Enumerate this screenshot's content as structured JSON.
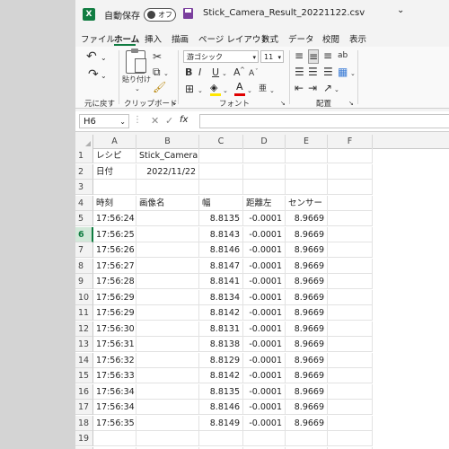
{
  "titlebar": {
    "excel_icon": "excel-logo",
    "autosave_label": "自動保存",
    "toggle_state": "オフ",
    "filename": "Stick_Camera_Result_20221122.csv",
    "filename_chevron": "⌄"
  },
  "tabs": [
    "ファイル",
    "ホーム",
    "挿入",
    "描画",
    "ページ レイアウト",
    "数式",
    "データ",
    "校閲",
    "表示"
  ],
  "active_tab": "ホーム",
  "ribbon": {
    "undo_label": "元に戻す",
    "clipboard_label": "クリップボード",
    "paste_label": "貼り付け",
    "font_label": "フォント",
    "alignment_label": "配置",
    "font_name": "游ゴシック",
    "font_size": "11",
    "bold": "B",
    "italic": "I",
    "underline": "U",
    "grow_font": "A",
    "shrink_font": "A",
    "font_color_letter": "A",
    "wrap_abbr": "ab",
    "accent_color": "#107c41"
  },
  "formula_bar": {
    "name_box": "H6",
    "cancel": "✕",
    "enter": "✓",
    "fx": "fx",
    "value": ""
  },
  "grid": {
    "columns": [
      "A",
      "B",
      "C",
      "D",
      "E",
      "F"
    ],
    "selected_row": "6",
    "rows": [
      {
        "n": "1",
        "a": "レシピ",
        "b": "Stick_Camera",
        "c": "",
        "d": "",
        "e": ""
      },
      {
        "n": "2",
        "a": "日付",
        "b": "2022/11/22",
        "c": "",
        "d": "",
        "e": ""
      },
      {
        "n": "3",
        "a": "",
        "b": "",
        "c": "",
        "d": "",
        "e": ""
      },
      {
        "n": "4",
        "a": "時刻",
        "b": "画像名",
        "c": "幅",
        "d": "距離左",
        "e": "センサー"
      },
      {
        "n": "5",
        "a": "17:56:24",
        "b": "",
        "c": "8.8135",
        "d": "-0.0001",
        "e": "8.9669"
      },
      {
        "n": "6",
        "a": "17:56:25",
        "b": "",
        "c": "8.8143",
        "d": "-0.0001",
        "e": "8.9669"
      },
      {
        "n": "7",
        "a": "17:56:26",
        "b": "",
        "c": "8.8146",
        "d": "-0.0001",
        "e": "8.9669"
      },
      {
        "n": "8",
        "a": "17:56:27",
        "b": "",
        "c": "8.8147",
        "d": "-0.0001",
        "e": "8.9669"
      },
      {
        "n": "9",
        "a": "17:56:28",
        "b": "",
        "c": "8.8141",
        "d": "-0.0001",
        "e": "8.9669"
      },
      {
        "n": "10",
        "a": "17:56:29",
        "b": "",
        "c": "8.8134",
        "d": "-0.0001",
        "e": "8.9669"
      },
      {
        "n": "11",
        "a": "17:56:29",
        "b": "",
        "c": "8.8142",
        "d": "-0.0001",
        "e": "8.9669"
      },
      {
        "n": "12",
        "a": "17:56:30",
        "b": "",
        "c": "8.8131",
        "d": "-0.0001",
        "e": "8.9669"
      },
      {
        "n": "13",
        "a": "17:56:31",
        "b": "",
        "c": "8.8138",
        "d": "-0.0001",
        "e": "8.9669"
      },
      {
        "n": "14",
        "a": "17:56:32",
        "b": "",
        "c": "8.8129",
        "d": "-0.0001",
        "e": "8.9669"
      },
      {
        "n": "15",
        "a": "17:56:33",
        "b": "",
        "c": "8.8142",
        "d": "-0.0001",
        "e": "8.9669"
      },
      {
        "n": "16",
        "a": "17:56:34",
        "b": "",
        "c": "8.8135",
        "d": "-0.0001",
        "e": "8.9669"
      },
      {
        "n": "17",
        "a": "17:56:34",
        "b": "",
        "c": "8.8146",
        "d": "-0.0001",
        "e": "8.9669"
      },
      {
        "n": "18",
        "a": "17:56:35",
        "b": "",
        "c": "8.8149",
        "d": "-0.0001",
        "e": "8.9669"
      },
      {
        "n": "19",
        "a": "",
        "b": "",
        "c": "",
        "d": "",
        "e": ""
      },
      {
        "n": "20",
        "a": "",
        "b": "",
        "c": "",
        "d": "",
        "e": ""
      }
    ]
  }
}
